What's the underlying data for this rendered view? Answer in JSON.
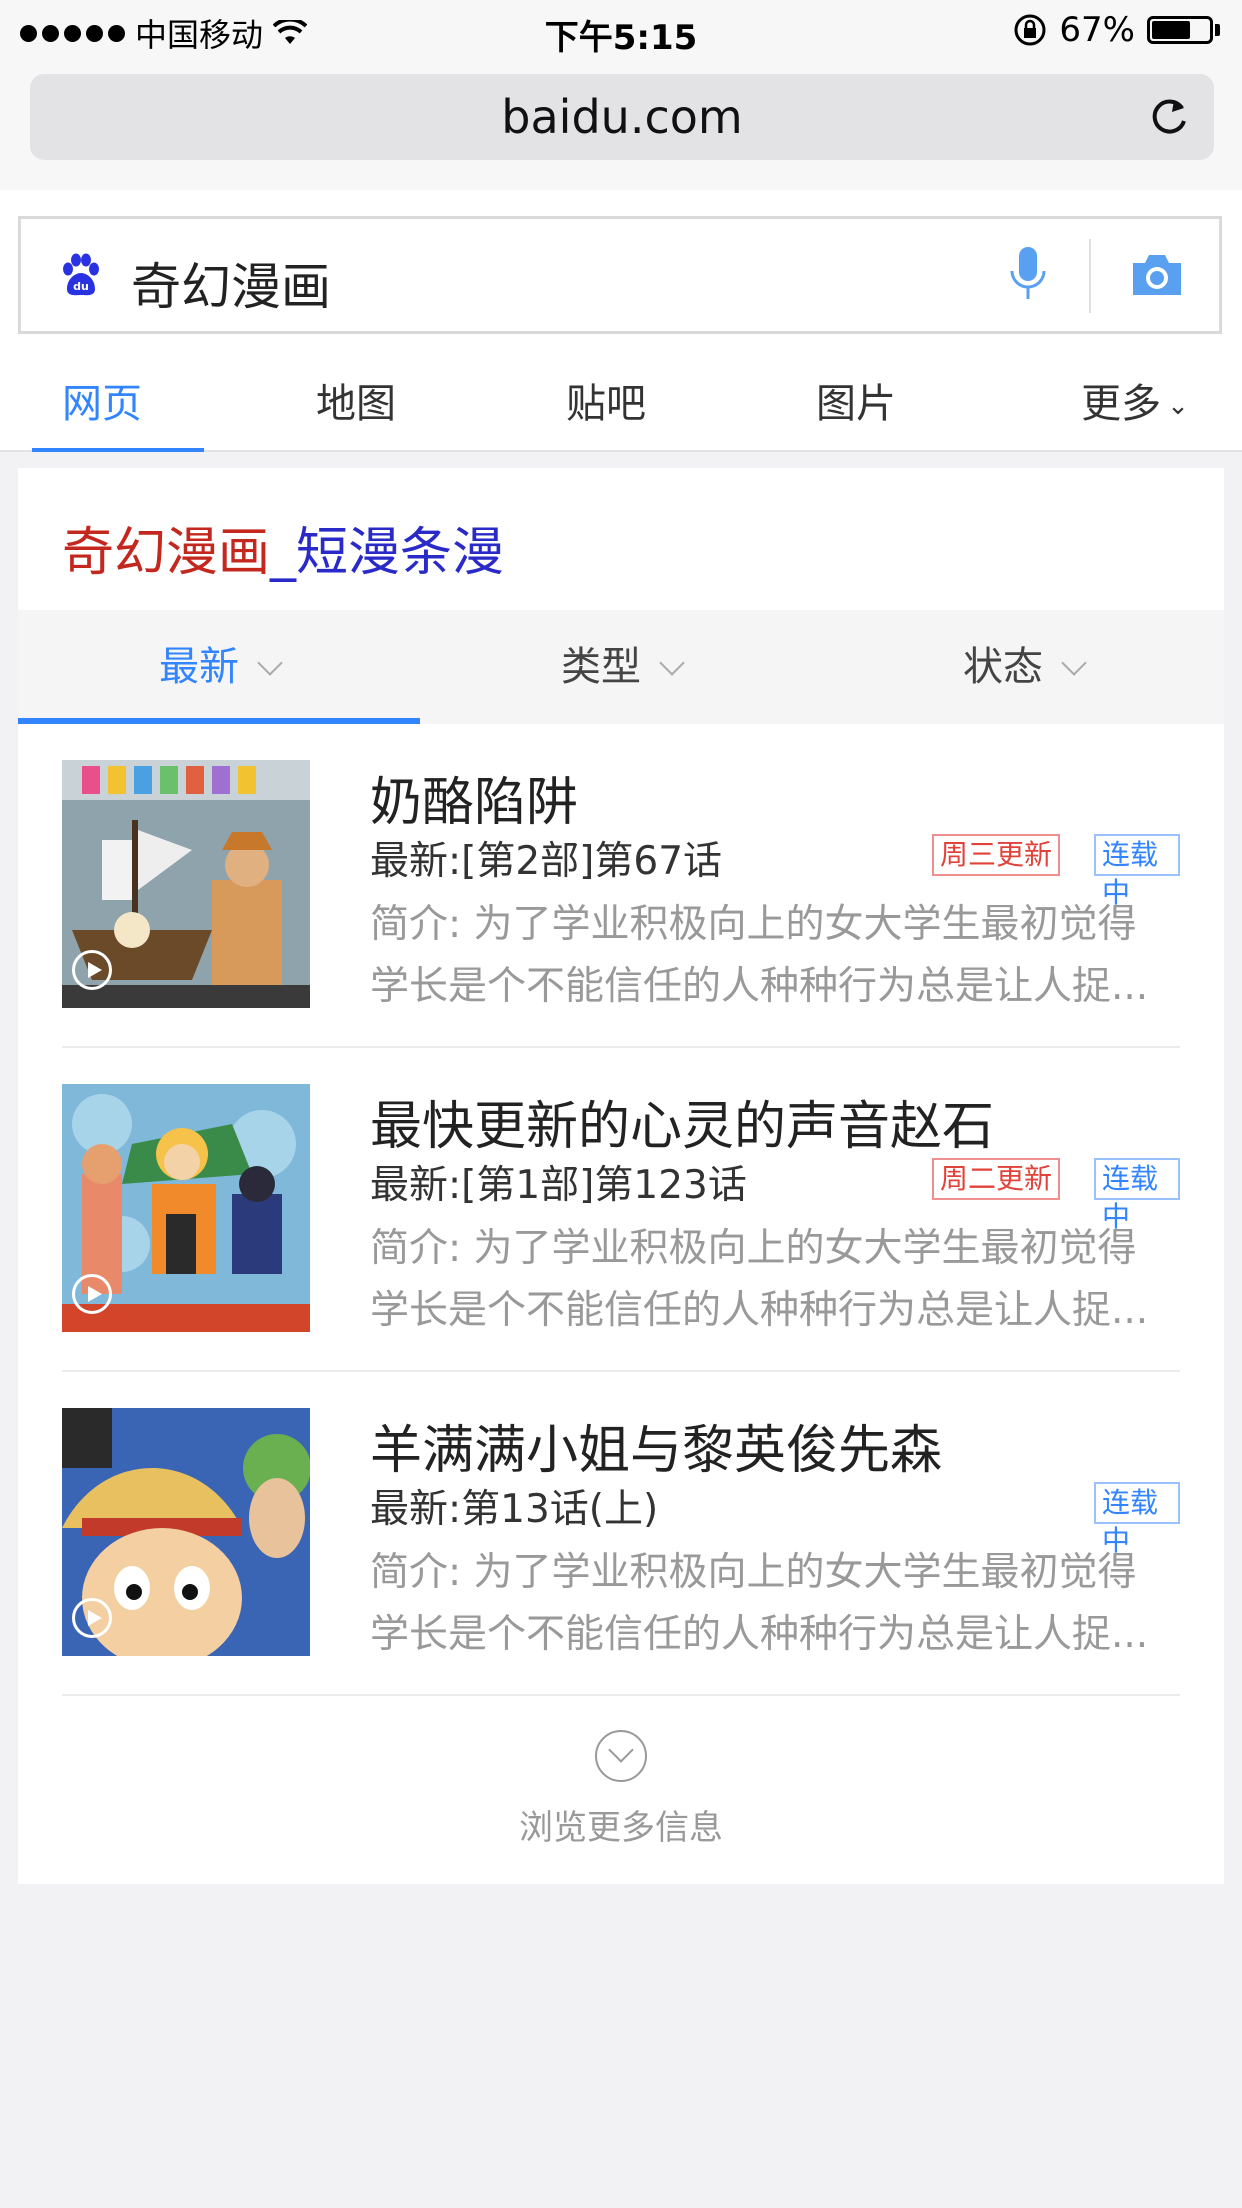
{
  "status_bar": {
    "carrier": "中国移动",
    "time": "下午5:15",
    "battery": "67%",
    "battery_level": 0.67
  },
  "address_bar": {
    "url": "baidu.com"
  },
  "search": {
    "query": "奇幻漫画"
  },
  "nav_tabs": [
    {
      "label": "网页",
      "active": true
    },
    {
      "label": "地图"
    },
    {
      "label": "贴吧"
    },
    {
      "label": "图片"
    },
    {
      "label": "更多"
    }
  ],
  "card": {
    "title_prefix": "奇幻漫画",
    "title_suffix": "_短漫条漫",
    "filters": [
      {
        "label": "最新",
        "active": true
      },
      {
        "label": "类型"
      },
      {
        "label": "状态"
      }
    ],
    "items": [
      {
        "title": "奶酪陷阱",
        "latest": "最新:[第2部]第67话",
        "update_badge": "周三更新",
        "status_badge": "连载中",
        "desc_line1": "简介: 为了学业积极向上的女大学生最初觉得",
        "desc_line2": "学长是个不能信任的人种种行为总是让人捉..."
      },
      {
        "title": "最快更新的心灵的声音赵石",
        "latest": "最新:[第1部]第123话",
        "update_badge": "周二更新",
        "status_badge": "连载中",
        "desc_line1": "简介: 为了学业积极向上的女大学生最初觉得",
        "desc_line2": "学长是个不能信任的人种种行为总是让人捉..."
      },
      {
        "title": "羊满满小姐与黎英俊先森",
        "latest": "最新:第13话(上)",
        "status_badge": "连载中",
        "desc_line1": "简介: 为了学业积极向上的女大学生最初觉得",
        "desc_line2": "学长是个不能信任的人种种行为总是让人捉..."
      }
    ],
    "more_label": "浏览更多信息"
  },
  "colors": {
    "accent": "#3385ff",
    "title_red": "#c4271e",
    "title_blue": "#2a2ac8",
    "badge_red": "#e0433a"
  }
}
